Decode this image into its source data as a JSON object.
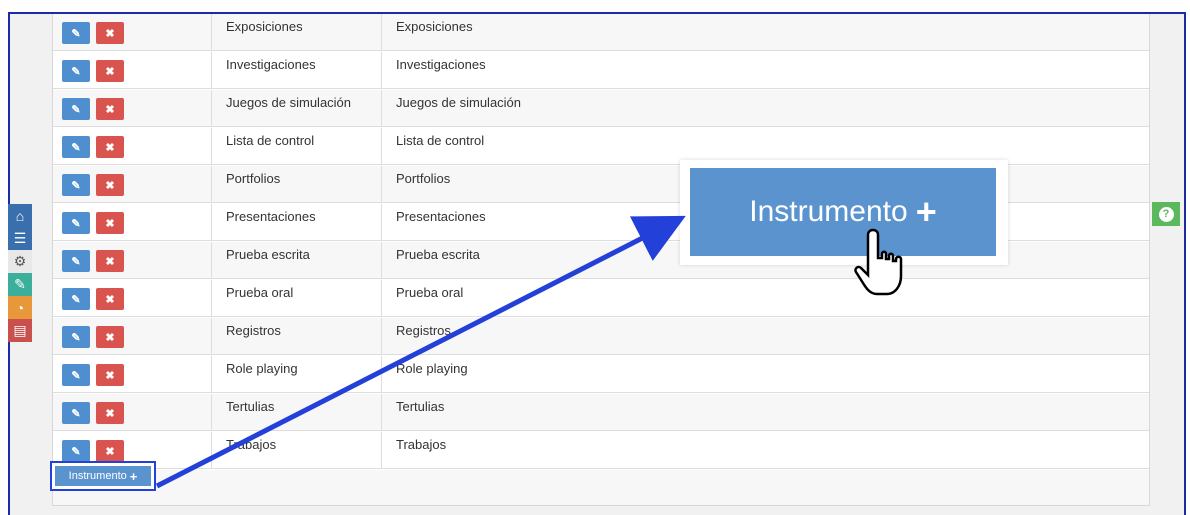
{
  "table": {
    "rows": [
      {
        "name": "Exposiciones",
        "description": "Exposiciones"
      },
      {
        "name": "Investigaciones",
        "description": "Investigaciones"
      },
      {
        "name": "Juegos de simulación",
        "description": "Juegos de simulación"
      },
      {
        "name": "Lista de control",
        "description": "Lista de control"
      },
      {
        "name": "Portfolios",
        "description": "Portfolios"
      },
      {
        "name": "Presentaciones",
        "description": "Presentaciones"
      },
      {
        "name": "Prueba escrita",
        "description": "Prueba escrita"
      },
      {
        "name": "Prueba oral",
        "description": "Prueba oral"
      },
      {
        "name": "Registros",
        "description": "Registros"
      },
      {
        "name": "Role playing",
        "description": "Role playing"
      },
      {
        "name": "Tertulias",
        "description": "Tertulias"
      },
      {
        "name": "Trabajos",
        "description": "Trabajos"
      }
    ],
    "edit_icon": "pencil-square-icon",
    "delete_icon": "close-icon"
  },
  "add_button": {
    "label": "Instrumento",
    "icon": "plus-icon"
  },
  "zoom_callout": {
    "label": "Instrumento",
    "icon": "plus-icon",
    "cursor": "hand-pointer-icon"
  },
  "sidebar": [
    {
      "icon": "home-icon",
      "color": "#3a6fae"
    },
    {
      "icon": "list-icon",
      "color": "#3a6fae"
    },
    {
      "icon": "gears-icon",
      "color": "#e8e8e8"
    },
    {
      "icon": "edit-icon",
      "color": "#3bae9c"
    },
    {
      "icon": "pie-chart-icon",
      "color": "#e8973a"
    },
    {
      "icon": "document-icon",
      "color": "#c9504c"
    }
  ],
  "help_icon": {
    "icon": "question-circle-icon",
    "color": "#5cb85c"
  },
  "colors": {
    "accent": "#5b93cf",
    "annotation": "#2340d9",
    "danger": "#d9534f"
  }
}
